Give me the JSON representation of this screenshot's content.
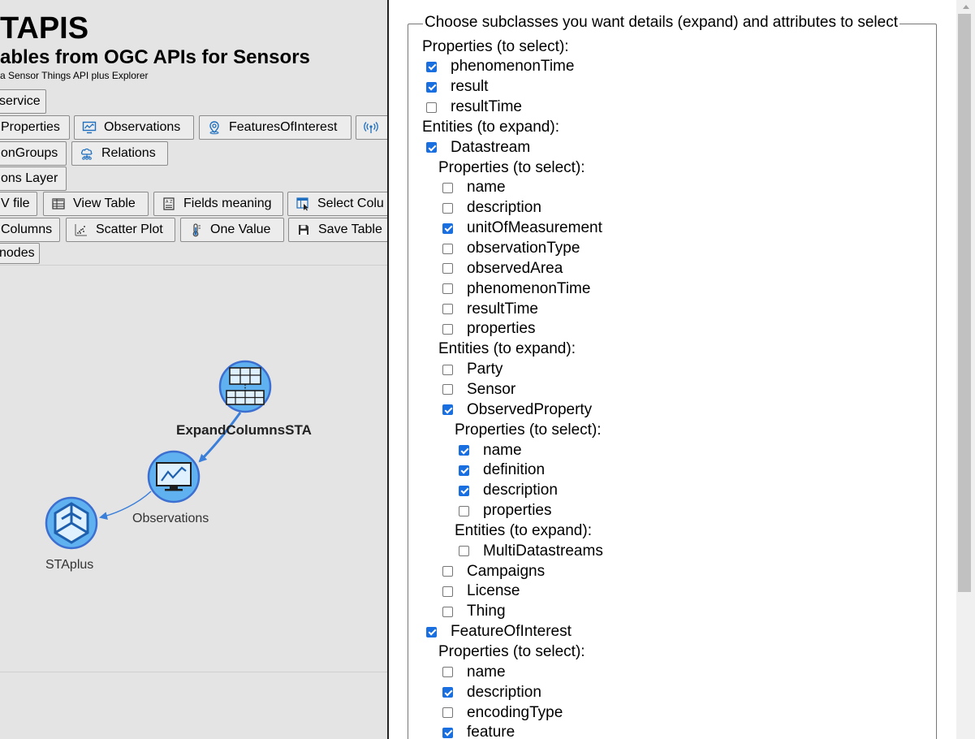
{
  "app": {
    "title": "TAPIS",
    "subtitle": "ables from OGC APIs for Sensors",
    "tagline": "a Sensor Things API plus Explorer"
  },
  "toolbar": {
    "service": "service",
    "properties": "Properties",
    "observations": "Observations",
    "features_of_interest": "FeaturesOfInterest",
    "observation_groups": "onGroups",
    "relations": "Relations",
    "observations_layer": "ons Layer",
    "csv_file": "V file",
    "view_table": "View Table",
    "fields_meaning": "Fields meaning",
    "select_columns": "Select Colu",
    "columns": "Columns",
    "scatter_plot": "Scatter Plot",
    "one_value": "One Value",
    "save_table": "Save Table",
    "nodes": "nodes"
  },
  "graph": {
    "nodes": [
      {
        "label": "ExpandColumnsSTA",
        "icon": "table-node-icon"
      },
      {
        "label": "Observations",
        "icon": "monitor-chart-icon"
      },
      {
        "label": "STAplus",
        "icon": "staplus-logo-icon"
      }
    ],
    "edge_color": "#3a7fd9",
    "node_fill": "#5fb2ef",
    "node_stroke": "#3c6fd0"
  },
  "dialog": {
    "legend": "Choose subclasses you want details (expand) and attributes to select",
    "rows": [
      {
        "label": "Properties (to select):",
        "level": 0,
        "header": true
      },
      {
        "label": "phenomenonTime",
        "level": 0,
        "checked": true
      },
      {
        "label": "result",
        "level": 0,
        "checked": true
      },
      {
        "label": "resultTime",
        "level": 0,
        "checked": false
      },
      {
        "label": "Entities (to expand):",
        "level": 0,
        "header": true
      },
      {
        "label": "Datastream",
        "level": 0,
        "checked": true
      },
      {
        "label": "Properties (to select):",
        "level": 1,
        "header": true
      },
      {
        "label": "name",
        "level": 1,
        "checked": false
      },
      {
        "label": "description",
        "level": 1,
        "checked": false
      },
      {
        "label": "unitOfMeasurement",
        "level": 1,
        "checked": true
      },
      {
        "label": "observationType",
        "level": 1,
        "checked": false
      },
      {
        "label": "observedArea",
        "level": 1,
        "checked": false
      },
      {
        "label": "phenomenonTime",
        "level": 1,
        "checked": false
      },
      {
        "label": "resultTime",
        "level": 1,
        "checked": false
      },
      {
        "label": "properties",
        "level": 1,
        "checked": false
      },
      {
        "label": "Entities (to expand):",
        "level": 1,
        "header": true
      },
      {
        "label": "Party",
        "level": 1,
        "checked": false
      },
      {
        "label": "Sensor",
        "level": 1,
        "checked": false
      },
      {
        "label": "ObservedProperty",
        "level": 1,
        "checked": true
      },
      {
        "label": "Properties (to select):",
        "level": 2,
        "header": true
      },
      {
        "label": "name",
        "level": 2,
        "checked": true
      },
      {
        "label": "definition",
        "level": 2,
        "checked": true
      },
      {
        "label": "description",
        "level": 2,
        "checked": true
      },
      {
        "label": "properties",
        "level": 2,
        "checked": false
      },
      {
        "label": "Entities (to expand):",
        "level": 2,
        "header": true
      },
      {
        "label": "MultiDatastreams",
        "level": 2,
        "checked": false
      },
      {
        "label": "Campaigns",
        "level": 1,
        "checked": false
      },
      {
        "label": "License",
        "level": 1,
        "checked": false
      },
      {
        "label": "Thing",
        "level": 1,
        "checked": false
      },
      {
        "label": "FeatureOfInterest",
        "level": 0,
        "checked": true
      },
      {
        "label": "Properties (to select):",
        "level": 1,
        "header": true
      },
      {
        "label": "name",
        "level": 1,
        "checked": false
      },
      {
        "label": "description",
        "level": 1,
        "checked": true
      },
      {
        "label": "encodingType",
        "level": 1,
        "checked": false
      },
      {
        "label": "feature",
        "level": 1,
        "checked": true
      }
    ]
  },
  "colors": {
    "checkbox_checked": "#1a6fe0",
    "left_background": "#e4e4e4"
  }
}
